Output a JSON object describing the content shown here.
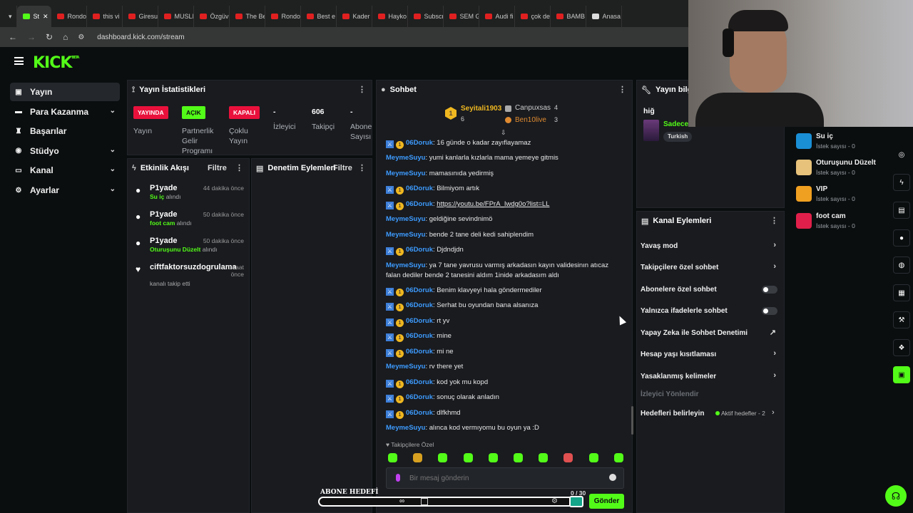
{
  "browser": {
    "tabs": [
      {
        "label": "St",
        "icon": "kick",
        "active": true
      },
      {
        "label": "Rondo",
        "icon": "youtube"
      },
      {
        "label": "this vi",
        "icon": "youtube"
      },
      {
        "label": "Giresu",
        "icon": "youtube"
      },
      {
        "label": "MUSLI",
        "icon": "youtube"
      },
      {
        "label": "Özgüv",
        "icon": "youtube"
      },
      {
        "label": "The Be",
        "icon": "youtube"
      },
      {
        "label": "Rondo",
        "icon": "youtube"
      },
      {
        "label": "Best e",
        "icon": "youtube"
      },
      {
        "label": "Kader",
        "icon": "youtube"
      },
      {
        "label": "Hayko",
        "icon": "youtube"
      },
      {
        "label": "Subscr",
        "icon": "youtube"
      },
      {
        "label": "SEM G",
        "icon": "youtube"
      },
      {
        "label": "Audi fi",
        "icon": "youtube"
      },
      {
        "label": "çok de",
        "icon": "youtube"
      },
      {
        "label": "BAMB",
        "icon": "youtube"
      },
      {
        "label": "Anasa",
        "icon": "x"
      }
    ],
    "url": "dashboard.kick.com/stream"
  },
  "header": {
    "logo": "KICK",
    "logo_sup": "BETA"
  },
  "sidebar": {
    "items": [
      {
        "label": "Yayın",
        "icon": "video-icon",
        "selected": true
      },
      {
        "label": "Para Kazanma",
        "icon": "money-icon",
        "chevron": true
      },
      {
        "label": "Başarılar",
        "icon": "trophy-icon"
      },
      {
        "label": "Stüdyo",
        "icon": "studio-icon",
        "chevron": true
      },
      {
        "label": "Kanal",
        "icon": "channel-icon",
        "chevron": true
      },
      {
        "label": "Ayarlar",
        "icon": "gear-icon",
        "chevron": true
      }
    ]
  },
  "stats": {
    "title": "Yayın İstatistikleri",
    "items": [
      {
        "badge": "YAYINDA",
        "label": "Yayın"
      },
      {
        "badge": "AÇIK",
        "label": "Partnerlik Gelir Programı"
      },
      {
        "badge": "KAPALI",
        "label": "Çoklu Yayın"
      },
      {
        "value": "-",
        "label": "İzleyici"
      },
      {
        "value": "606",
        "label": "Takipçi"
      },
      {
        "value": "-",
        "label": "Abone Sayısı"
      }
    ]
  },
  "activity": {
    "title": "Etkinlik Akışı",
    "filter": "Filtre",
    "items": [
      {
        "user": "P1yade",
        "reward": "Su iç",
        "suffix": "alındı",
        "time": "44 dakika önce"
      },
      {
        "user": "P1yade",
        "reward": "foot cam",
        "suffix": "alındı",
        "time": "50 dakika önce"
      },
      {
        "user": "P1yade",
        "reward": "Oturuşunu Düzelt",
        "suffix": "alındı",
        "time": "50 dakika önce"
      },
      {
        "user": "ciftfaktorsuzdogrulama",
        "reward": "",
        "suffix": "kanalı takip etti",
        "time": "1 saat önce"
      }
    ]
  },
  "moderation": {
    "title": "Denetim Eylemleri",
    "filter": "Filtre"
  },
  "chat": {
    "title": "Sohbet",
    "pinned": [
      {
        "name": "Seyitali1903",
        "count": "6"
      },
      {
        "name": "Canpuxsas",
        "count": "4"
      },
      {
        "name": "Ben10live",
        "count": "3"
      }
    ],
    "messages": [
      {
        "user": "06Doruk",
        "badges": true,
        "text": "16 günde o kadar zayıflayamaz"
      },
      {
        "user": "MeymeSuyu",
        "badges": false,
        "text": "yumi kanlarla kızlarla mama yemeye gitmis"
      },
      {
        "user": "MeymeSuyu",
        "badges": false,
        "text": "mamasınıda yedirmiş"
      },
      {
        "user": "06Doruk",
        "badges": true,
        "text": "Bilmiyom artık"
      },
      {
        "user": "06Doruk",
        "badges": true,
        "text": "https://youtu.be/FPrA_Iwdg0o?list=LL",
        "link": true
      },
      {
        "user": "MeymeSuyu",
        "badges": false,
        "text": "geldiğine sevindnimö"
      },
      {
        "user": "MeymeSuyu",
        "badges": false,
        "text": "bende 2 tane deli kedi sahiplendim"
      },
      {
        "user": "06Doruk",
        "badges": true,
        "text": "Djdndjdn"
      },
      {
        "user": "MeymeSuyu",
        "badges": false,
        "text": "ya 7 tane yavrusu varmış arkadasın kayın validesinın atıcaz falan dediler bende 2 tanesini aldım 1inide arkadasım aldı"
      },
      {
        "user": "06Doruk",
        "badges": true,
        "text": "Benim klavyeyi hala göndermediler"
      },
      {
        "user": "06Doruk",
        "badges": true,
        "text": "Serhat bu oyundan bana alsanıza"
      },
      {
        "user": "06Doruk",
        "badges": true,
        "text": "rt yv"
      },
      {
        "user": "06Doruk",
        "badges": true,
        "text": "mine"
      },
      {
        "user": "06Doruk",
        "badges": true,
        "text": "mi ne"
      },
      {
        "user": "MeymeSuyu",
        "badges": false,
        "text": "rv there yet"
      },
      {
        "user": "06Doruk",
        "badges": true,
        "text": "kod yok mu kopd"
      },
      {
        "user": "06Doruk",
        "badges": true,
        "text": "sonuç olarak anladın"
      },
      {
        "user": "06Doruk",
        "badges": true,
        "text": "dlfkhmd"
      },
      {
        "user": "MeymeSuyu",
        "badges": false,
        "text": "alınca kod vermıyomu bu oyun ya :D"
      }
    ],
    "followers_only": "Takipçilere Özel",
    "input_placeholder": "Bir mesaj gönderin",
    "char_count": "0 / 30",
    "send_label": "Gönder",
    "sub_goal_label": "ABONE HEDEFİ"
  },
  "stream_info": {
    "title": "Yayın bilgisi",
    "stream_title": "hiğ",
    "category": "Sadece sohbet",
    "language": "Turkish"
  },
  "rewards": [
    {
      "title": "Su iç",
      "sub": "İstek sayısı - 0",
      "color": "#1a8fd6"
    },
    {
      "title": "Oturuşunu Düzelt",
      "sub": "İstek sayısı - 0",
      "color": "#e6c27a"
    },
    {
      "title": "VIP",
      "sub": "İstek sayısı - 0",
      "color": "#f0a020"
    },
    {
      "title": "foot cam",
      "sub": "İstek sayısı - 0",
      "color": "#e0204a"
    }
  ],
  "channel_actions": {
    "title": "Kanal Eylemleri",
    "items": [
      {
        "label": "Yavaş mod",
        "type": "arrow"
      },
      {
        "label": "Takipçilere özel sohbet",
        "type": "arrow"
      },
      {
        "label": "Abonelere özel sohbet",
        "type": "toggle"
      },
      {
        "label": "Yalnızca ifadelerle sohbet",
        "type": "toggle"
      },
      {
        "label": "Yapay Zeka ile Sohbet Denetimi",
        "type": "external"
      },
      {
        "label": "Hesap yaşı kısıtlaması",
        "type": "arrow"
      },
      {
        "label": "Yasaklanmış kelimeler",
        "type": "arrow"
      }
    ],
    "raid_label": "İzleyici Yönlendir",
    "goals_label": "Hedefleri belirleyin",
    "goals_status": "Aktif hedefler - 2"
  },
  "colors": {
    "accent": "#53fc18",
    "live": "#e9113c",
    "panel": "#191b1f",
    "bg": "#0b0e0f"
  }
}
